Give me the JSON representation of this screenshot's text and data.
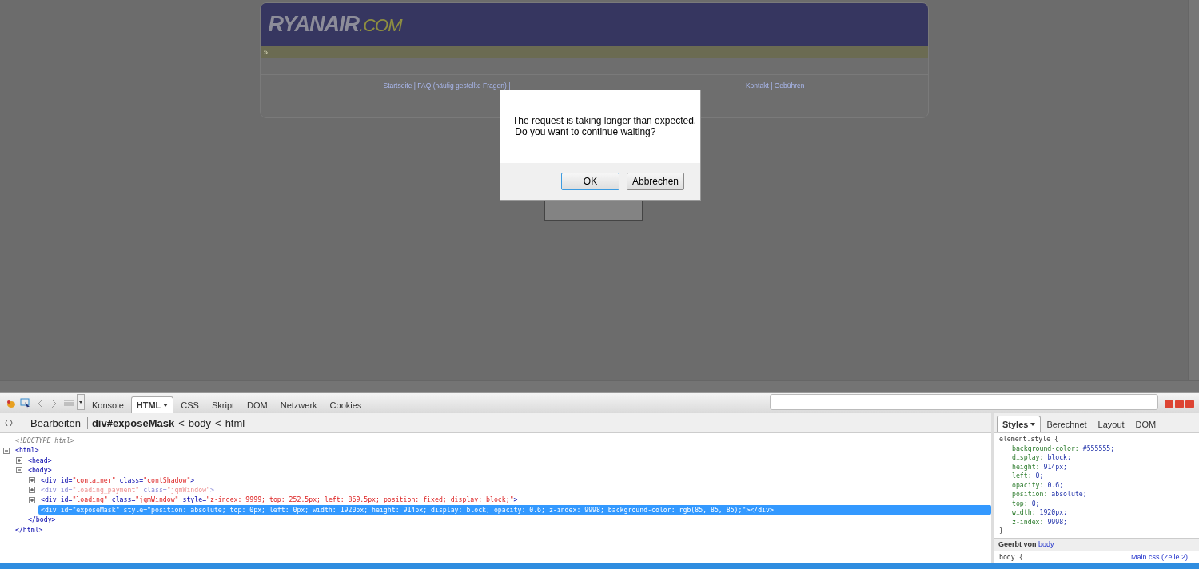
{
  "page": {
    "logo": {
      "main": "RYANAIR",
      "suffix": ".COM"
    },
    "trail_marker": "»",
    "footer_left": "Startseite | FAQ (häufig gestellte Fragen) |",
    "footer_right": "| Kontakt | Gebühren"
  },
  "dialog": {
    "lines": [
      "The request is taking longer than expected.",
      " Do you want to continue waiting?"
    ],
    "buttons": [
      {
        "label": "OK",
        "selected": true
      },
      {
        "label": "Abbrechen",
        "selected": false
      }
    ]
  },
  "devtools": {
    "tabs": [
      {
        "label": "Konsole",
        "selected": false,
        "dropdown": false
      },
      {
        "label": "HTML",
        "selected": true,
        "dropdown": true
      },
      {
        "label": "CSS",
        "selected": false,
        "dropdown": false
      },
      {
        "label": "Skript",
        "selected": false,
        "dropdown": false
      },
      {
        "label": "DOM",
        "selected": false,
        "dropdown": false
      },
      {
        "label": "Netzwerk",
        "selected": false,
        "dropdown": false
      },
      {
        "label": "Cookies",
        "selected": false,
        "dropdown": false
      }
    ],
    "edit_label": "Bearbeiten",
    "separator": "<",
    "breadcrumb": [
      {
        "label": "div#exposeMask",
        "selected": true
      },
      {
        "label": "body",
        "selected": false
      },
      {
        "label": "html",
        "selected": false
      }
    ],
    "tree": [
      {
        "tokens": [
          {
            "kind": "comment",
            "text": "<!DOCTYPE html>"
          }
        ],
        "selected": false,
        "hidden": false
      },
      {
        "tokens": [
          {
            "kind": "tag",
            "text": "<html>"
          }
        ],
        "expanded": true,
        "selected": false,
        "hidden": false,
        "closing": "</html>",
        "children": [
          {
            "tokens": [
              {
                "kind": "tag",
                "text": "<head>"
              }
            ],
            "expanded": false,
            "selected": false,
            "hidden": false
          },
          {
            "tokens": [
              {
                "kind": "tag",
                "text": "<body>"
              }
            ],
            "expanded": true,
            "selected": false,
            "hidden": false,
            "closing": "</body>",
            "children": [
              {
                "tokens": [
                  {
                    "kind": "tag",
                    "text": "<div"
                  },
                  {
                    "kind": "attr",
                    "text": " id="
                  },
                  {
                    "kind": "value",
                    "text": "\"container\""
                  },
                  {
                    "kind": "attr",
                    "text": " class="
                  },
                  {
                    "kind": "value",
                    "text": "\"contShadow\""
                  },
                  {
                    "kind": "tag",
                    "text": ">"
                  }
                ],
                "expanded": false,
                "selected": false,
                "hidden": false
              },
              {
                "tokens": [
                  {
                    "kind": "tag",
                    "text": "<div"
                  },
                  {
                    "kind": "attr",
                    "text": " id="
                  },
                  {
                    "kind": "value",
                    "text": "\"loading_payment\""
                  },
                  {
                    "kind": "attr",
                    "text": " class="
                  },
                  {
                    "kind": "value",
                    "text": "\"jqmWindow\""
                  },
                  {
                    "kind": "tag",
                    "text": ">"
                  }
                ],
                "expanded": false,
                "selected": false,
                "hidden": true
              },
              {
                "tokens": [
                  {
                    "kind": "tag",
                    "text": "<div"
                  },
                  {
                    "kind": "attr",
                    "text": " id="
                  },
                  {
                    "kind": "value",
                    "text": "\"loading\""
                  },
                  {
                    "kind": "attr",
                    "text": " class="
                  },
                  {
                    "kind": "value",
                    "text": "\"jqmWindow\""
                  },
                  {
                    "kind": "attr",
                    "text": " style="
                  },
                  {
                    "kind": "value",
                    "text": "\"z-index: 9999; top: 252.5px; left: 869.5px; position: fixed; display: block;\""
                  },
                  {
                    "kind": "tag",
                    "text": ">"
                  }
                ],
                "expanded": false,
                "selected": false,
                "hidden": false
              },
              {
                "tokens": [
                  {
                    "kind": "tag",
                    "text": "<div"
                  },
                  {
                    "kind": "attr",
                    "text": " id="
                  },
                  {
                    "kind": "value",
                    "text": "\"exposeMask\""
                  },
                  {
                    "kind": "attr",
                    "text": " style="
                  },
                  {
                    "kind": "value",
                    "text": "\"position: absolute; top: 0px; left: 0px; width: 1920px; height: 914px; display: block; opacity: 0.6; z-index: 9998; background-color: rgb(85, 85, 85);\""
                  },
                  {
                    "kind": "tag",
                    "text": "></div>"
                  }
                ],
                "selected": true,
                "hidden": false
              }
            ]
          }
        ]
      }
    ],
    "side_tabs": [
      {
        "label": "Styles",
        "selected": true,
        "dropdown": true
      },
      {
        "label": "Berechnet",
        "selected": false,
        "dropdown": false
      },
      {
        "label": "Layout",
        "selected": false,
        "dropdown": false
      },
      {
        "label": "DOM",
        "selected": false,
        "dropdown": false
      }
    ],
    "rule": {
      "selector": "element.style {",
      "properties": [
        {
          "name": "background-color:",
          "value": "#555555;"
        },
        {
          "name": "display:",
          "value": "block;"
        },
        {
          "name": "height:",
          "value": "914px;"
        },
        {
          "name": "left:",
          "value": "0;"
        },
        {
          "name": "opacity:",
          "value": "0.6;"
        },
        {
          "name": "position:",
          "value": "absolute;"
        },
        {
          "name": "top:",
          "value": "0;"
        },
        {
          "name": "width:",
          "value": "1920px;"
        },
        {
          "name": "z-index:",
          "value": "9998;"
        }
      ],
      "close": "}"
    },
    "inherited": {
      "label": "Geerbt von",
      "link": "body"
    },
    "next_rule": {
      "selector": "body {",
      "source": "Main.css (Zeile 2)"
    }
  }
}
